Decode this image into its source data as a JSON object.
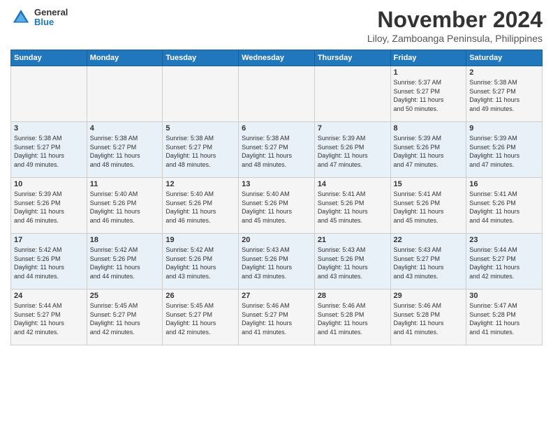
{
  "logo": {
    "general": "General",
    "blue": "Blue"
  },
  "header": {
    "title": "November 2024",
    "subtitle": "Liloy, Zamboanga Peninsula, Philippines"
  },
  "days_of_week": [
    "Sunday",
    "Monday",
    "Tuesday",
    "Wednesday",
    "Thursday",
    "Friday",
    "Saturday"
  ],
  "weeks": [
    [
      {
        "day": "",
        "info": ""
      },
      {
        "day": "",
        "info": ""
      },
      {
        "day": "",
        "info": ""
      },
      {
        "day": "",
        "info": ""
      },
      {
        "day": "",
        "info": ""
      },
      {
        "day": "1",
        "info": "Sunrise: 5:37 AM\nSunset: 5:27 PM\nDaylight: 11 hours\nand 50 minutes."
      },
      {
        "day": "2",
        "info": "Sunrise: 5:38 AM\nSunset: 5:27 PM\nDaylight: 11 hours\nand 49 minutes."
      }
    ],
    [
      {
        "day": "3",
        "info": "Sunrise: 5:38 AM\nSunset: 5:27 PM\nDaylight: 11 hours\nand 49 minutes."
      },
      {
        "day": "4",
        "info": "Sunrise: 5:38 AM\nSunset: 5:27 PM\nDaylight: 11 hours\nand 48 minutes."
      },
      {
        "day": "5",
        "info": "Sunrise: 5:38 AM\nSunset: 5:27 PM\nDaylight: 11 hours\nand 48 minutes."
      },
      {
        "day": "6",
        "info": "Sunrise: 5:38 AM\nSunset: 5:27 PM\nDaylight: 11 hours\nand 48 minutes."
      },
      {
        "day": "7",
        "info": "Sunrise: 5:39 AM\nSunset: 5:26 PM\nDaylight: 11 hours\nand 47 minutes."
      },
      {
        "day": "8",
        "info": "Sunrise: 5:39 AM\nSunset: 5:26 PM\nDaylight: 11 hours\nand 47 minutes."
      },
      {
        "day": "9",
        "info": "Sunrise: 5:39 AM\nSunset: 5:26 PM\nDaylight: 11 hours\nand 47 minutes."
      }
    ],
    [
      {
        "day": "10",
        "info": "Sunrise: 5:39 AM\nSunset: 5:26 PM\nDaylight: 11 hours\nand 46 minutes."
      },
      {
        "day": "11",
        "info": "Sunrise: 5:40 AM\nSunset: 5:26 PM\nDaylight: 11 hours\nand 46 minutes."
      },
      {
        "day": "12",
        "info": "Sunrise: 5:40 AM\nSunset: 5:26 PM\nDaylight: 11 hours\nand 46 minutes."
      },
      {
        "day": "13",
        "info": "Sunrise: 5:40 AM\nSunset: 5:26 PM\nDaylight: 11 hours\nand 45 minutes."
      },
      {
        "day": "14",
        "info": "Sunrise: 5:41 AM\nSunset: 5:26 PM\nDaylight: 11 hours\nand 45 minutes."
      },
      {
        "day": "15",
        "info": "Sunrise: 5:41 AM\nSunset: 5:26 PM\nDaylight: 11 hours\nand 45 minutes."
      },
      {
        "day": "16",
        "info": "Sunrise: 5:41 AM\nSunset: 5:26 PM\nDaylight: 11 hours\nand 44 minutes."
      }
    ],
    [
      {
        "day": "17",
        "info": "Sunrise: 5:42 AM\nSunset: 5:26 PM\nDaylight: 11 hours\nand 44 minutes."
      },
      {
        "day": "18",
        "info": "Sunrise: 5:42 AM\nSunset: 5:26 PM\nDaylight: 11 hours\nand 44 minutes."
      },
      {
        "day": "19",
        "info": "Sunrise: 5:42 AM\nSunset: 5:26 PM\nDaylight: 11 hours\nand 43 minutes."
      },
      {
        "day": "20",
        "info": "Sunrise: 5:43 AM\nSunset: 5:26 PM\nDaylight: 11 hours\nand 43 minutes."
      },
      {
        "day": "21",
        "info": "Sunrise: 5:43 AM\nSunset: 5:26 PM\nDaylight: 11 hours\nand 43 minutes."
      },
      {
        "day": "22",
        "info": "Sunrise: 5:43 AM\nSunset: 5:27 PM\nDaylight: 11 hours\nand 43 minutes."
      },
      {
        "day": "23",
        "info": "Sunrise: 5:44 AM\nSunset: 5:27 PM\nDaylight: 11 hours\nand 42 minutes."
      }
    ],
    [
      {
        "day": "24",
        "info": "Sunrise: 5:44 AM\nSunset: 5:27 PM\nDaylight: 11 hours\nand 42 minutes."
      },
      {
        "day": "25",
        "info": "Sunrise: 5:45 AM\nSunset: 5:27 PM\nDaylight: 11 hours\nand 42 minutes."
      },
      {
        "day": "26",
        "info": "Sunrise: 5:45 AM\nSunset: 5:27 PM\nDaylight: 11 hours\nand 42 minutes."
      },
      {
        "day": "27",
        "info": "Sunrise: 5:46 AM\nSunset: 5:27 PM\nDaylight: 11 hours\nand 41 minutes."
      },
      {
        "day": "28",
        "info": "Sunrise: 5:46 AM\nSunset: 5:28 PM\nDaylight: 11 hours\nand 41 minutes."
      },
      {
        "day": "29",
        "info": "Sunrise: 5:46 AM\nSunset: 5:28 PM\nDaylight: 11 hours\nand 41 minutes."
      },
      {
        "day": "30",
        "info": "Sunrise: 5:47 AM\nSunset: 5:28 PM\nDaylight: 11 hours\nand 41 minutes."
      }
    ]
  ]
}
